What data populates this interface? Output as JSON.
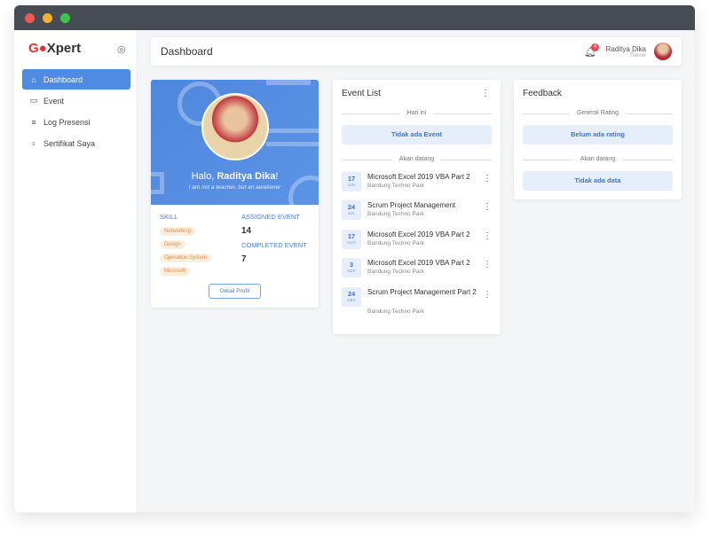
{
  "window": {
    "controls": [
      "close",
      "minimize",
      "maximize"
    ]
  },
  "sidebar": {
    "logo": "GOXpert",
    "items": [
      {
        "label": "Dashboard",
        "icon": "home-icon",
        "active": true
      },
      {
        "label": "Event",
        "icon": "calendar-icon"
      },
      {
        "label": "Log Presensi",
        "icon": "list-icon"
      },
      {
        "label": "Sertifikat Saya",
        "icon": "award-icon"
      }
    ]
  },
  "header": {
    "title": "Dashboard",
    "notifications": "4",
    "user_name": "Raditya Dika",
    "user_role": "Trainer"
  },
  "profile": {
    "greeting": "Halo, ",
    "name": "Raditya Dika",
    "exclaim": "!",
    "quote": "I am not a teacher, but an awakener",
    "skill_label": "SKILL",
    "skills": [
      "Networking",
      "Design",
      "Operation System",
      "Microsoft"
    ],
    "assigned_label": "ASSIGNED EVENT",
    "assigned": "14",
    "completed_label": "COMPLETED EVENT",
    "completed": "7",
    "detail_button": "Detail Profil"
  },
  "events": {
    "title": "Event List",
    "today_label": "Hari ini",
    "today_empty": "Tidak ada Event",
    "upcoming_label": "Akan datang",
    "items": [
      {
        "day": "17",
        "month": "JUN",
        "title": "Microsoft Excel 2019 VBA Part 2",
        "location": "Bandung Techno Park"
      },
      {
        "day": "24",
        "month": "JUL",
        "title": "Scrum Project Management",
        "location": "Bandung Techno Park"
      },
      {
        "day": "17",
        "month": "AUG",
        "title": "Microsoft Excel 2019 VBA Part 2",
        "location": "Bandung Techno Park"
      },
      {
        "day": "3",
        "month": "SEP",
        "title": "Microsoft Excel 2019 VBA Part 2",
        "location": "Bandung Techno Park"
      },
      {
        "day": "24",
        "month": "DES",
        "title": "Scrum Project Management Part 2",
        "location": "Bandung Techno Park"
      }
    ]
  },
  "feedback": {
    "title": "Feedback",
    "rating_label": "General Rating",
    "rating_empty": "Belum ada rating",
    "upcoming_label": "Akan datang",
    "upcoming_empty": "Tidak ada data"
  },
  "colors": {
    "accent": "#4f8ae3",
    "titlebar": "#474c54",
    "tag_bg": "#fdeee2",
    "tag_text": "#f08a3c"
  }
}
